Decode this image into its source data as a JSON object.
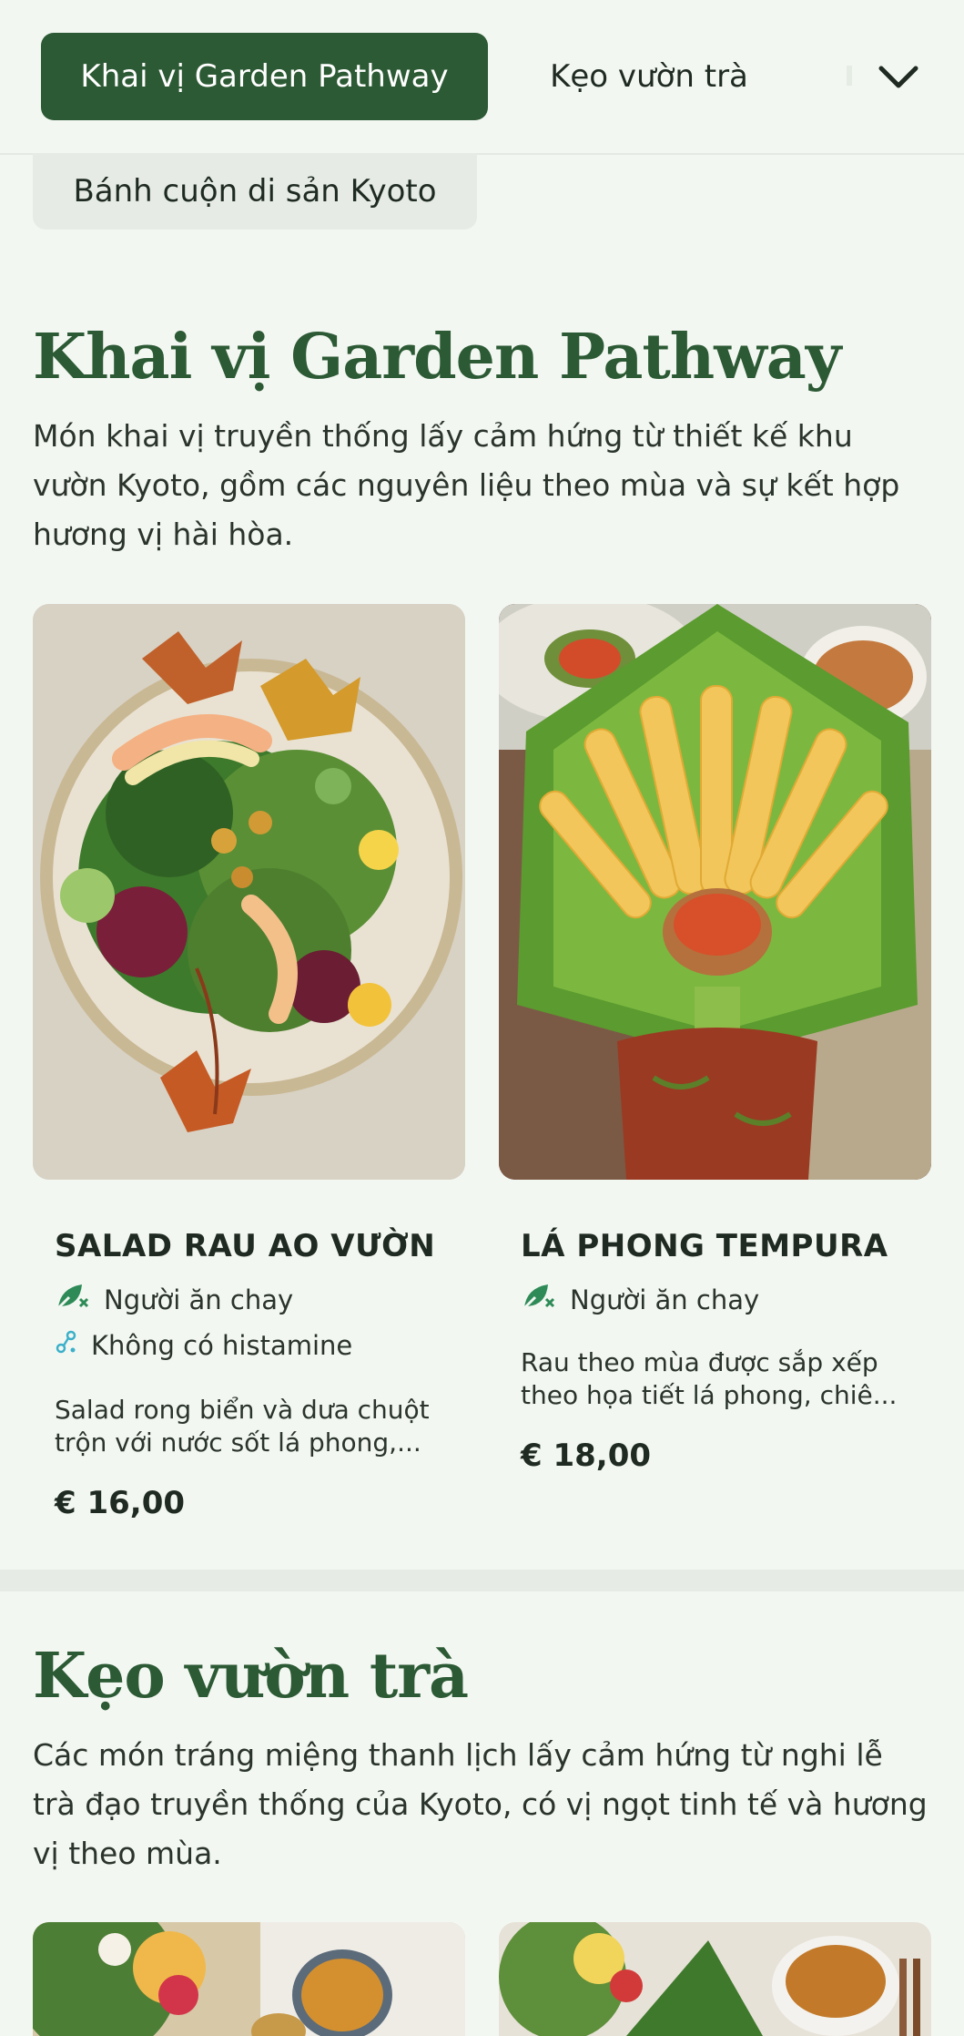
{
  "nav": {
    "active_tab": "Khai vị Garden Pathway",
    "tab2": "Kẹo vườn trà",
    "tab3": "Bánh cuộn di sản Kyoto"
  },
  "sections": [
    {
      "title": "Khai vị Garden Pathway",
      "description": "Món khai vị truyền thống lấy cảm hứng từ thiết kế khu vườn Kyoto, gồm các nguyên liệu theo mùa và sự kết hợp hương vị hài hòa.",
      "items": [
        {
          "name": "SALAD RAU AO VƯỜN",
          "tags": [
            "Người ăn chay",
            "Không có histamine"
          ],
          "description": "Salad rong biển và dưa chuột trộn với nước sốt lá phong,...",
          "price": "€ 16,00"
        },
        {
          "name": "LÁ PHONG TEMPURA",
          "tags": [
            "Người ăn chay"
          ],
          "description": "Rau theo mùa được sắp xếp theo họa tiết lá phong, chiê...",
          "price": "€ 18,00"
        }
      ]
    },
    {
      "title": "Kẹo vườn trà",
      "description": "Các món tráng miệng thanh lịch lấy cảm hứng từ nghi lễ trà đạo truyền thống của Kyoto, có vị ngọt tinh tế và hương vị theo mùa."
    }
  ],
  "icons": {
    "vegan": "leaf-cross-icon",
    "histamine": "molecule-icon",
    "dropdown": "chevron-down-icon"
  },
  "colors": {
    "primary": "#2c5a34",
    "background": "#f3f7f2",
    "tag_vegan": "#2e8b57",
    "tag_histamine": "#3bb0c9"
  }
}
